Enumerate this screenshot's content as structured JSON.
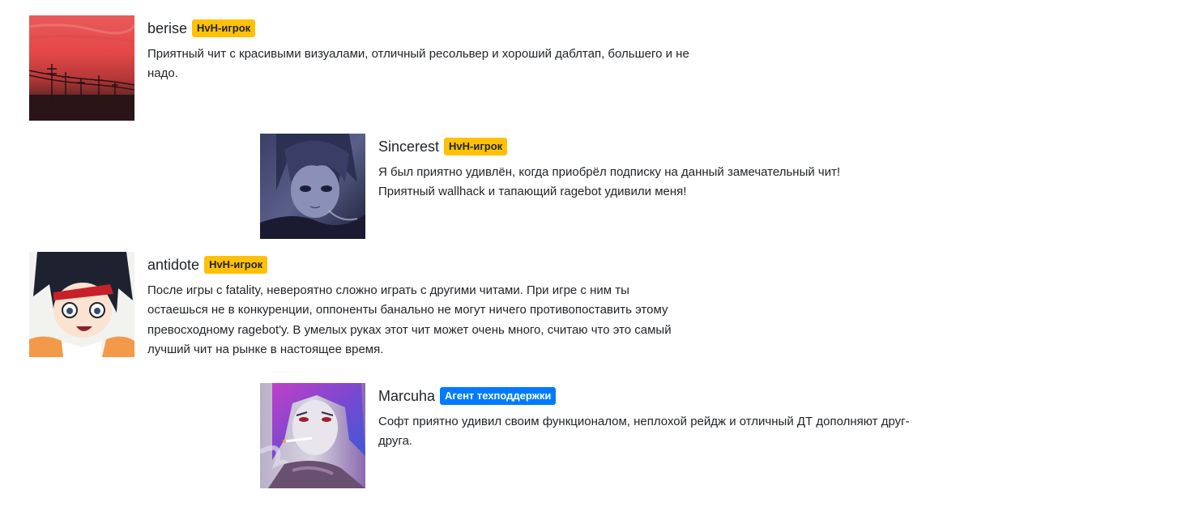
{
  "reviews": [
    {
      "username": "berise",
      "badge": "HvH-игрок",
      "badge_color": "#ffc107",
      "avatar": "sunset-power-lines-avatar",
      "text": "Приятный чит с красивыми визуалами, отличный ресольвер и хороший даблтап, большего и не надо."
    },
    {
      "username": "Sincerest",
      "badge": "HvH-игрок",
      "badge_color": "#ffc107",
      "avatar": "anime-girl-dark-avatar",
      "text": "Я был приятно удивлён, когда приобрёл подписку на данный замечательный чит! Приятный wallhack и тапающий ragebot удивили меня!"
    },
    {
      "username": "antidote",
      "badge": "HvH-игрок",
      "badge_color": "#ffc107",
      "avatar": "anime-girl-shocked-avatar",
      "text": "После игры с fatality, невероятно сложно играть с другими читами. При игре с ним ты остаешься не в конкуренции, оппоненты банально не могут ничего противопоставить этому превосходному ragebot'у. В умелых руках этот чит может очень много, считаю что это самый лучший чит на рынке в настоящее время."
    },
    {
      "username": "Marcuha",
      "badge": "Агент техподдержки",
      "badge_color": "#007bff",
      "avatar": "anime-smoking-purple-hair-avatar",
      "text": "Софт приятно удивил своим функционалом, неплохой рейдж и отличный ДТ дополняют друг-друга."
    }
  ]
}
